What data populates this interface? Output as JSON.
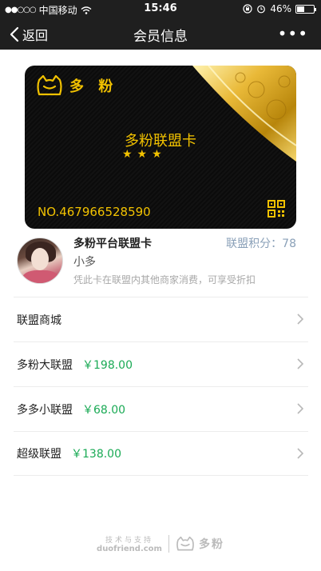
{
  "status_bar": {
    "signal": "●●○○○",
    "carrier": "中国移动",
    "time": "15:46",
    "battery": "46%",
    "battery_level": 0.46
  },
  "nav": {
    "back_label": "返回",
    "title": "会员信息",
    "more_label": "•••"
  },
  "card": {
    "brand": "多 粉",
    "title": "多粉联盟卡",
    "stars": "★★★",
    "number": "NO.467966528590",
    "accent_color": "#f2c200"
  },
  "member": {
    "card_name": "多粉平台联盟卡",
    "points_label": "联盟积分：78",
    "username": "小多",
    "description": "凭此卡在联盟内其他商家消费，可享受折扣"
  },
  "list": [
    {
      "label": "联盟商城",
      "price": ""
    },
    {
      "label": "多粉大联盟",
      "price": "￥198.00"
    },
    {
      "label": "多多小联盟",
      "price": "￥68.00"
    },
    {
      "label": "超级联盟",
      "price": "￥138.00"
    }
  ],
  "footer": {
    "tech": "技术与支持",
    "domain": "duofriend.com",
    "brand": "多粉"
  },
  "colors": {
    "price_green": "#1aaa55",
    "points_blue": "#8aa0b8",
    "nav_bg": "#1f1f1f"
  }
}
